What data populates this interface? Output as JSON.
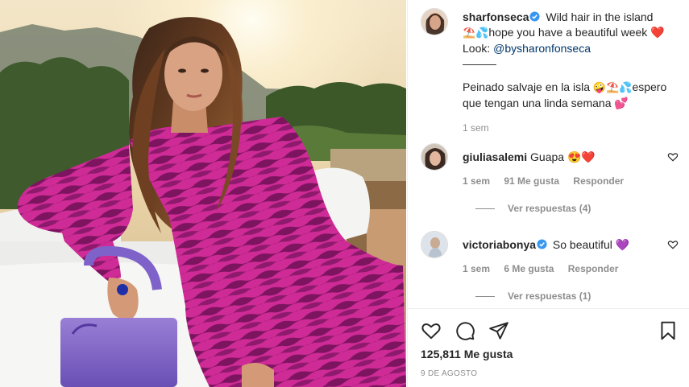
{
  "post": {
    "username": "sharfonseca",
    "caption_line1": "Wild hair in the island",
    "caption_line2": "hope you have a beautiful week",
    "caption_look_prefix": "Look:",
    "caption_look_link": "@bysharonfonseca",
    "caption_divider": "———",
    "caption_es_line1": "Peinado salvaje en la isla",
    "caption_es_line1b": "espero",
    "caption_es_line2": "que tengan una linda semana",
    "time": "1 sem"
  },
  "comments": [
    {
      "username": "giuliasalemi",
      "text": "Guapa",
      "time": "1 sem",
      "likes": "91 Me gusta",
      "reply_label": "Responder",
      "view_replies": "Ver respuestas (4)"
    },
    {
      "username": "victoriabonya",
      "text": "So beautiful",
      "time": "1 sem",
      "likes": "6 Me gusta",
      "reply_label": "Responder",
      "view_replies": "Ver respuestas (1)"
    }
  ],
  "footer": {
    "likes": "125,811 Me gusta",
    "date": "9 DE AGOSTO"
  },
  "icons": [
    "verified-badge-icon",
    "heart-icon",
    "comment-icon",
    "share-icon",
    "bookmark-icon"
  ],
  "colors": {
    "verified_blue": "#3897f0",
    "text": "#262626",
    "muted": "#8e8e8e",
    "link": "#00376b",
    "dress": "#c4268e"
  }
}
